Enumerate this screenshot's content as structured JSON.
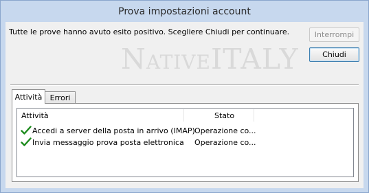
{
  "window": {
    "title": "Prova impostazioni account"
  },
  "message": "Tutte le prove hanno avuto esito positivo. Scegliere Chiudi per continuare.",
  "buttons": {
    "stop_label": "Interrompi",
    "close_label": "Chiudi"
  },
  "watermark": {
    "n": "N",
    "ative": "ATIVE",
    "italy": "ITALY"
  },
  "tabs": [
    {
      "label": "Attività",
      "selected": true
    },
    {
      "label": "Errori",
      "selected": false
    }
  ],
  "table": {
    "columns": [
      "Attività",
      "Stato"
    ],
    "rows": [
      {
        "activity": "Accedi a server della posta in arrivo (IMAP)",
        "status": "Operazione co...",
        "icon": "checkmark-icon"
      },
      {
        "activity": "Invia messaggio prova posta elettronica",
        "status": "Operazione co...",
        "icon": "checkmark-icon"
      }
    ]
  },
  "colors": {
    "titlebar": "#c7d8ee",
    "check": "#1b8a1b",
    "default_button_border": "#3c7fb1"
  }
}
